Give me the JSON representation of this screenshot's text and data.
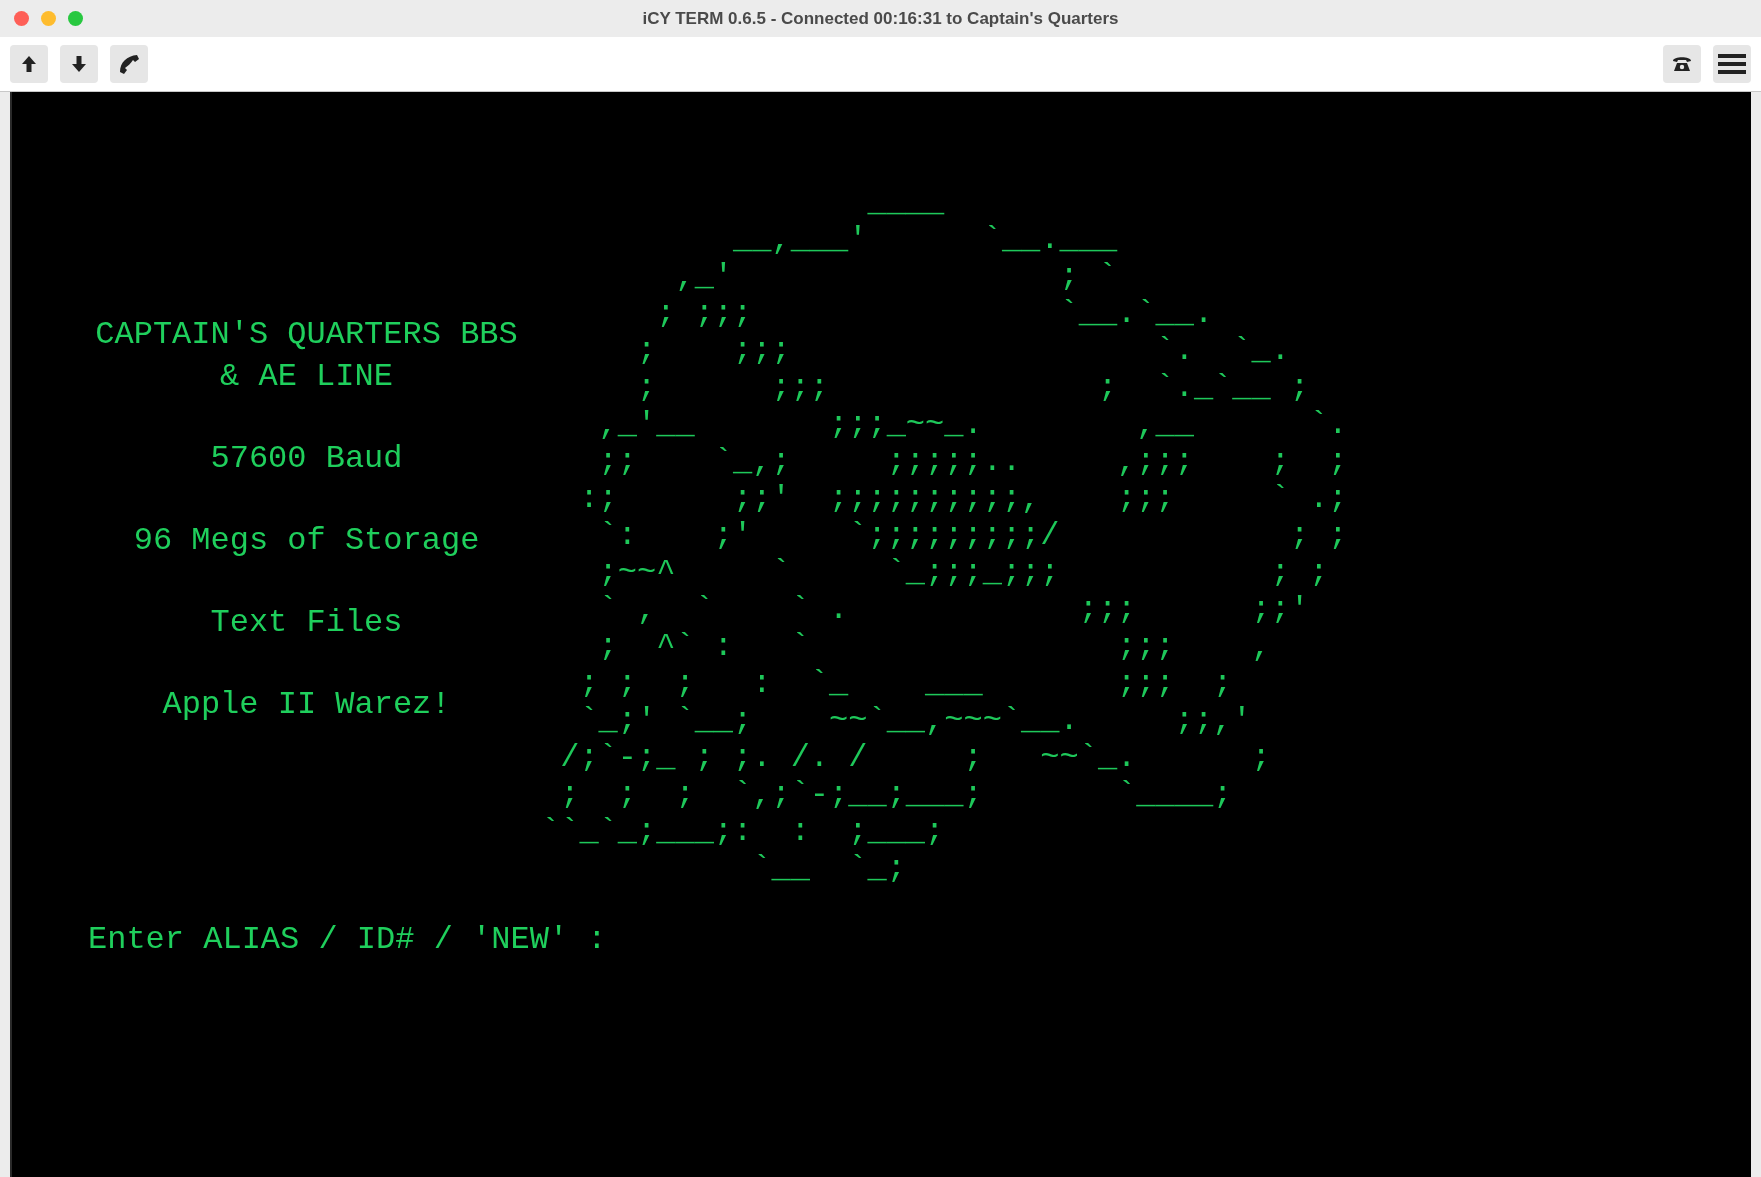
{
  "window": {
    "title": "iCY TERM 0.6.5 - Connected 00:16:31 to Captain's Quarters"
  },
  "terminal": {
    "banner": [
      "CAPTAIN'S QUARTERS BBS",
      "& AE LINE"
    ],
    "features": [
      "57600 Baud",
      "96 Megs of Storage",
      "Text Files",
      "Apple II Warez!"
    ],
    "art_lines": [
      "                 ____",
      "          __,___'      `__.___",
      "       ,_'                 ; `",
      "      ; ;;;                `__.`__.",
      "     ;    ;;;                   `.  `_.",
      "     ;      ;;;              ;  `._`__ ;",
      "   ,_'__       ;;;_~~_.        ,__      `.",
      "   ;;    `_,;     ;;;;;..     ,;;;    ;  ;",
      "  :;      ;;'  ;;;;;;;;;;,    ;;;     ` .;",
      "   `:    ;'     `;;;;;;;;;/            ; ;",
      "   ;~~^     `     `_;;;_;;;           ; ;",
      "   ` ,  `    ` .            ;;;      ;;'",
      "   ;  ^` :   `                ;;;    ,",
      "  ; ;  ;   :  `_    ___       ;;;  ;",
      "  `_;' `__;    ~~`__,~~~`__.     ;;,'",
      " /;`-;_ ; ;. /. /     ;   ~~`_.      ;",
      " ;  ;  ;  `,;`-;__;___;       `____;",
      "``_`_;___;:  :  ;___;",
      "           `__  `_;"
    ],
    "prompt": "Enter ALIAS / ID# / 'NEW' :"
  }
}
